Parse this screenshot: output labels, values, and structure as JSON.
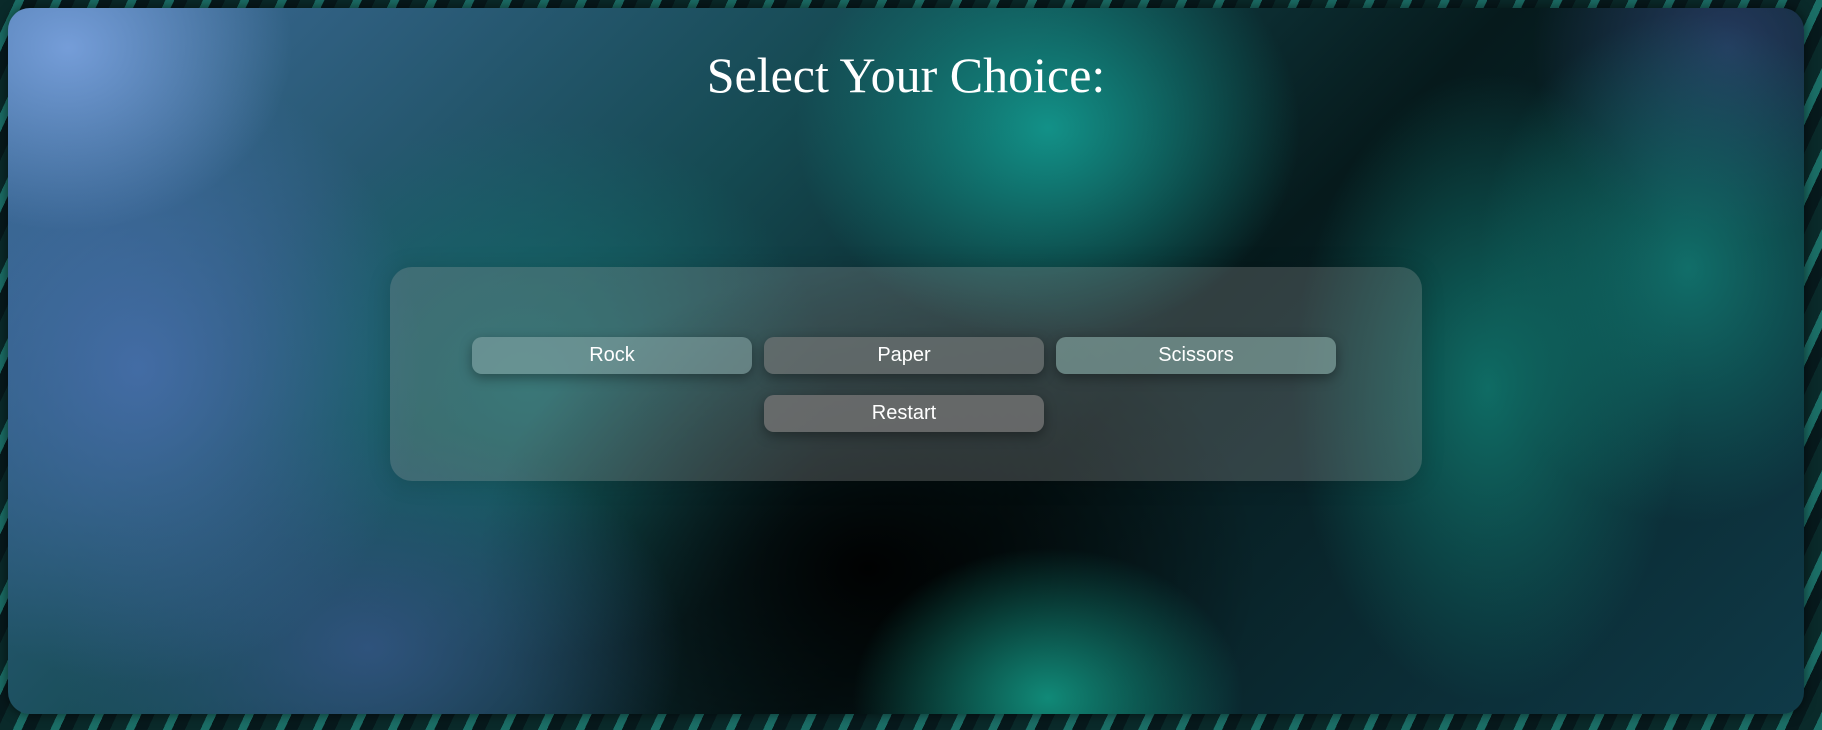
{
  "header": {
    "title": "Select Your Choice:"
  },
  "choices": {
    "rock_label": "Rock",
    "paper_label": "Paper",
    "scissors_label": "Scissors"
  },
  "controls": {
    "restart_label": "Restart"
  }
}
